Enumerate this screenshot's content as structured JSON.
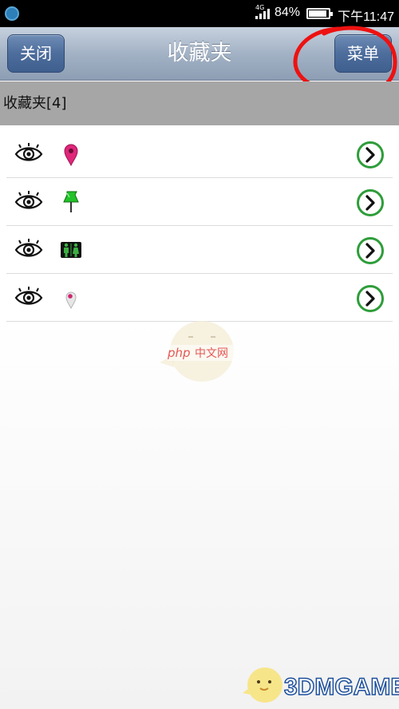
{
  "status_bar": {
    "network": "4G",
    "battery": "84%",
    "battery_level": 0.84,
    "time": "下午11:47"
  },
  "header": {
    "title": "收藏夹",
    "close_label": "关闭",
    "menu_label": "菜单"
  },
  "section": {
    "label": "收藏夹[4]"
  },
  "favorites": [
    {
      "marker_icon": "pink-map-pin-icon",
      "marker_color": "#e0267a"
    },
    {
      "marker_icon": "green-pushpin-icon",
      "marker_color": "#22c22a"
    },
    {
      "marker_icon": "restroom-icon",
      "marker_color": "#3cb043"
    },
    {
      "marker_icon": "grey-map-pin-icon",
      "marker_color": "#d8d8d8"
    }
  ],
  "colors": {
    "chevron_green": "#2e9d3a",
    "annotation_red": "#ee1111",
    "title_bar": "#a3b2c5",
    "button_blue": "#4d6d9c",
    "section_grey": "#a6a6a6"
  },
  "watermarks": {
    "center_logo": "php中文网",
    "bottom_logo": "3DMGAME"
  }
}
